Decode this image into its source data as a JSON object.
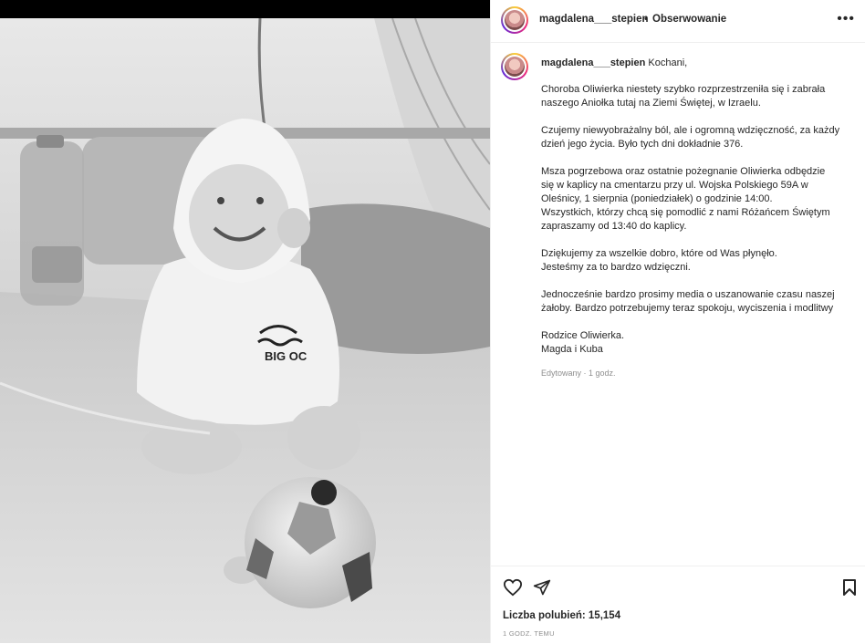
{
  "post": {
    "username": "magdalena___stepien",
    "follow_label": "Obserwowanie",
    "separator": "•",
    "more_label": "•••"
  },
  "caption": {
    "username": "magdalena___stepien",
    "greeting": "Kochani,",
    "paragraphs": [
      "Choroba Oliwierka niestety szybko rozprzestrzeniła się i zabrała\nnaszego Aniołka tutaj na Ziemi Świętej, w Izraelu.",
      "Czujemy niewyobrażalny ból, ale i ogromną wdzięczność, za każdy\ndzień jego życia. Było tych dni dokładnie 376.",
      "Msza pogrzebowa oraz ostatnie pożegnanie Oliwierka odbędzie\nsię w kaplicy na cmentarzu przy ul. Wojska Polskiego 59A w\nOleśnicy, 1 sierpnia (poniedziałek) o godzinie 14:00.\nWszystkich, którzy chcą się pomodlić z nami Różańcem Świętym\nzapraszamy od 13:40 do kaplicy.",
      "Dziękujemy za wszelkie dobro, które od Was płynęło.\nJesteśmy za to bardzo wdzięczni.",
      "Jednocześnie bardzo prosimy media o uszanowanie czasu naszej\nżałoby. Bardzo potrzebujemy teraz spokoju, wyciszenia i modlitwy",
      "Rodzice Oliwierka.\nMagda i Kuba"
    ],
    "edited": "Edytowany · 1 godz."
  },
  "engagement": {
    "likes_label": "Liczba polubień: 15,154",
    "time_ago": "1 GODZ. TEMU"
  },
  "photo": {
    "shirt_text": "BIG OC"
  },
  "icons": [
    "heart-icon",
    "share-icon",
    "bookmark-icon",
    "more-icon"
  ]
}
